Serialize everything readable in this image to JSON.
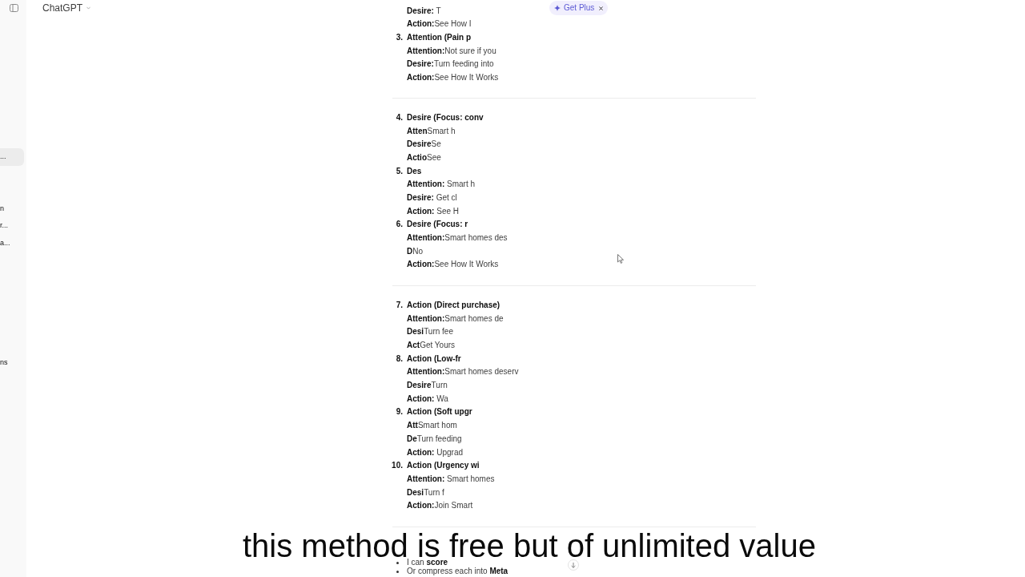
{
  "header": {
    "title": "ChatGPT",
    "upgrade_label": "Get Plus"
  },
  "sidebar": {
    "groups": [
      {
        "items": [
          {
            "label": "...",
            "selected": true
          }
        ]
      },
      {
        "items": [
          {
            "label": "n",
            "selected": false
          },
          {
            "label": "r...",
            "selected": false
          },
          {
            "label": "a...",
            "selected": false
          }
        ]
      },
      {
        "items": [
          {
            "label": "ns",
            "selected": false
          }
        ]
      }
    ]
  },
  "sections": [
    {
      "kind": "numbered",
      "items": [
        {
          "lines": [
            "**Desire:** T",
            "**Action:**See How I"
          ]
        },
        {
          "number": "3.",
          "heading": "Attention (Pain p",
          "lines": [
            "**Attention:**Not sure if you",
            "**Desire:**Turn feeding into",
            "**Action:**See How It Works"
          ]
        }
      ]
    },
    {
      "kind": "numbered",
      "items": [
        {
          "number": "4.",
          "heading": "Desire (Focus: conv",
          "lines": [
            "**Atten**Smart h",
            "**Desire**Se",
            "**Actio**See"
          ]
        },
        {
          "number": "5.",
          "heading": "Des",
          "lines": [
            "**Attention:** Smart h",
            "**Desire:** Get cl",
            "**Action:** See H"
          ]
        },
        {
          "number": "6.",
          "heading": "Desire (Focus: r",
          "lines": [
            "**Attention:**Smart homes des",
            "**D**No",
            "**Action:**See How It Works"
          ]
        }
      ]
    },
    {
      "kind": "numbered",
      "items": [
        {
          "number": "7.",
          "heading": "Action (Direct purchase)",
          "lines": [
            "**Attention:**Smart homes de",
            "**Desi**Turn fee",
            "**Act**Get Yours"
          ]
        },
        {
          "number": "8.",
          "heading": "Action (Low-fr",
          "lines": [
            "**Attention:**Smart homes deserv",
            "**Desire**Turn",
            "**Action:** Wa"
          ]
        },
        {
          "number": "9.",
          "heading": "Action (Soft upgr",
          "lines": [
            "**Att**Smart hom",
            "**De**Turn feeding",
            "**Action:** Upgrad"
          ]
        },
        {
          "number": "10.",
          "heading": "Action (Urgency wi",
          "lines": [
            "**Attention:** Smart homes",
            "**Desi**Turn f",
            "**Action:**Join Smart"
          ]
        }
      ]
    },
    {
      "kind": "bullets",
      "items": [
        "I can **score**",
        "Or compress each into **Meta**"
      ]
    }
  ],
  "caption": "this method is free but of unlimited value"
}
